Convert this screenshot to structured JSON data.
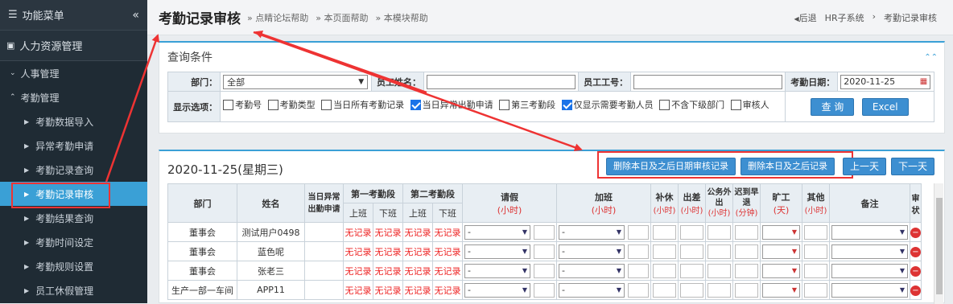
{
  "sidebar": {
    "header": "功能菜单",
    "section": "人力资源管理",
    "groups": [
      "人事管理",
      "考勤管理"
    ],
    "items": [
      {
        "label": "考勤数据导入"
      },
      {
        "label": "异常考勤申请"
      },
      {
        "label": "考勤记录查询"
      },
      {
        "label": "考勤记录审核",
        "active": true
      },
      {
        "label": "考勤结果查询"
      },
      {
        "label": "考勤时间设定"
      },
      {
        "label": "考勤规则设置"
      },
      {
        "label": "员工休假管理"
      }
    ]
  },
  "topbar": {
    "title": "考勤记录审核",
    "links": [
      "点睛论坛帮助",
      "本页面帮助",
      "本模块帮助"
    ],
    "back": "后退",
    "crumb": [
      "HR子系统",
      "考勤记录审核"
    ]
  },
  "query": {
    "title": "查询条件",
    "dept_label": "部门：",
    "dept_value": "全部",
    "name_label": "员工姓名：",
    "no_label": "员工工号：",
    "date_label": "考勤日期：",
    "date_value": "2020-11-25",
    "options_label": "显示选项：",
    "options": [
      {
        "label": "考勤号",
        "checked": false
      },
      {
        "label": "考勤类型",
        "checked": false
      },
      {
        "label": "当日所有考勤记录",
        "checked": false
      },
      {
        "label": "当日异常出勤申请",
        "checked": true
      },
      {
        "label": "第三考勤段",
        "checked": false
      },
      {
        "label": "仅显示需要考勤人员",
        "checked": true
      },
      {
        "label": "不含下级部门",
        "checked": false
      },
      {
        "label": "审核人",
        "checked": false
      }
    ],
    "query_btn": "查 询",
    "excel_btn": "Excel"
  },
  "records": {
    "date_title": "2020-11-25(星期三)",
    "buttons": [
      "删除本日及之后日期审核记录",
      "删除本日及之后记录",
      "上一天",
      "下一天"
    ],
    "headers": {
      "dept": "部门",
      "name": "姓名",
      "abnormal": "当日异常出勤申请",
      "seg1": "第一考勤段",
      "seg2": "第二考勤段",
      "on": "上班",
      "off": "下班",
      "leave": "请假",
      "overtime": "加班",
      "comp": "补休",
      "trip": "出差",
      "out": "公务外出",
      "late": "迟到早退",
      "absent": "旷工",
      "other": "其他",
      "note": "备注",
      "audit": "审状"
    },
    "units": {
      "hour": "(小时)",
      "minute": "(分钟)",
      "day": "(天)"
    },
    "no_record": "无记录",
    "dash": "-",
    "rows": [
      {
        "dept": "董事会",
        "name": "测试用户0498"
      },
      {
        "dept": "董事会",
        "name": "蓝色呢"
      },
      {
        "dept": "董事会",
        "name": "张老三"
      },
      {
        "dept": "生产一部一车间",
        "name": "APP11"
      }
    ]
  }
}
